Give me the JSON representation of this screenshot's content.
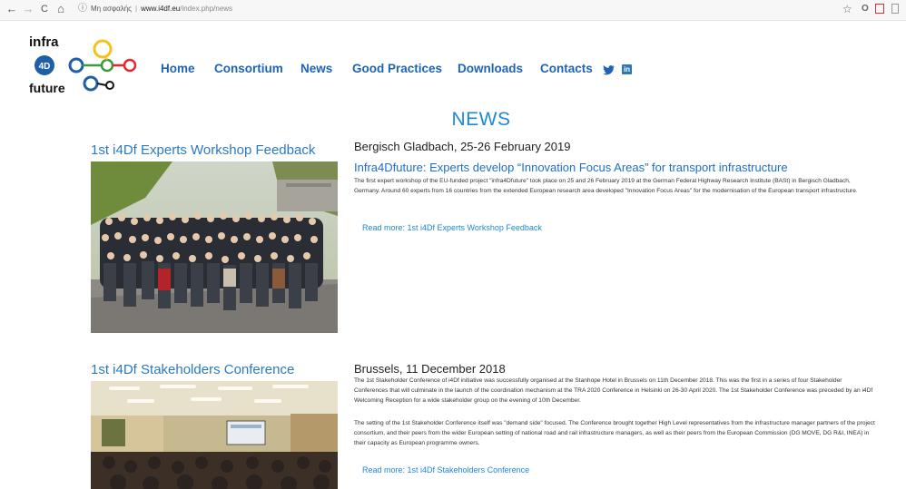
{
  "browser": {
    "url_prefix": "Μη ασφαλής",
    "url_host": "www.i4df.eu",
    "url_path": "/index.php/news",
    "back_glyph": "←",
    "forward_glyph": "→",
    "reload_glyph": "C",
    "home_glyph": "⌂",
    "info_glyph": "ⓘ",
    "star_glyph": "☆",
    "opera_glyph": "O"
  },
  "logo": {
    "line1": "infra",
    "badge": "4D",
    "line3": "future",
    "colors": {
      "yellow": "#f4c21a",
      "green": "#3a9a3e",
      "red": "#e8262f",
      "blue": "#1f5fa8",
      "black": "#111111"
    }
  },
  "nav": {
    "items": [
      {
        "label": "Home"
      },
      {
        "label": "Consortium"
      },
      {
        "label": "News"
      },
      {
        "label": "Good Practices"
      },
      {
        "label": "Downloads"
      },
      {
        "label": "Contacts"
      }
    ],
    "linkedin_label": "in",
    "accent": "#1e64b4"
  },
  "page": {
    "heading": "NEWS",
    "heading_color": "#1e88d8"
  },
  "articles": [
    {
      "title": "1st i4Df Experts Workshop Feedback",
      "location_date": "Bergisch Gladbach, 25-26 February 2019",
      "headline": "Infra4Dfuture: Experts develop “Innovation Focus Areas” for transport infrastructure",
      "body": "The first expert workshop of the EU-funded project \"infra4Dfuture\" took place on 25 and 26 February 2019 at the German Federal Highway Research Institute (BASt) in Bergisch Gladbach, Germany. Around 60 experts from 16 countries from the extended European research area developed \"Innovation Focus Areas\" for the modernisation of the European transport infrastructure.",
      "read_more": "Read more: 1st i4Df Experts Workshop Feedback"
    },
    {
      "title": "1st i4Df Stakeholders Conference",
      "location_date": "Brussels, 11 December 2018",
      "body": "The 1st Stakeholder Conference of i4Df initiative was successfully organised at the Stanhope Hotel in Brussels on 11th December 2018. This was the first in a series of four Stakeholder Conferences that will culminate in the launch of the coordination mechanism at the TRA 2020 Conference in Helsinki on 26-30 April 2020. The 1st Stakeholder Conference was preceded by an i4Df Welcoming Reception for a wide stakeholder group on the evening of 10th December.",
      "body2": "The setting of the 1st Stakeholder Conference itself was \"demand side\" focused. The Conference brought together High Level representatives from the infrastructure manager partners of the project consortium, and their peers from the wider European setting of national road and rail infrastructure managers, as well as their peers from the European Commission (DG MOVE, DG R&I, INEA) in their capacity as European programme owners.",
      "read_more": "Read more: 1st i4Df Stakeholders Conference"
    }
  ]
}
